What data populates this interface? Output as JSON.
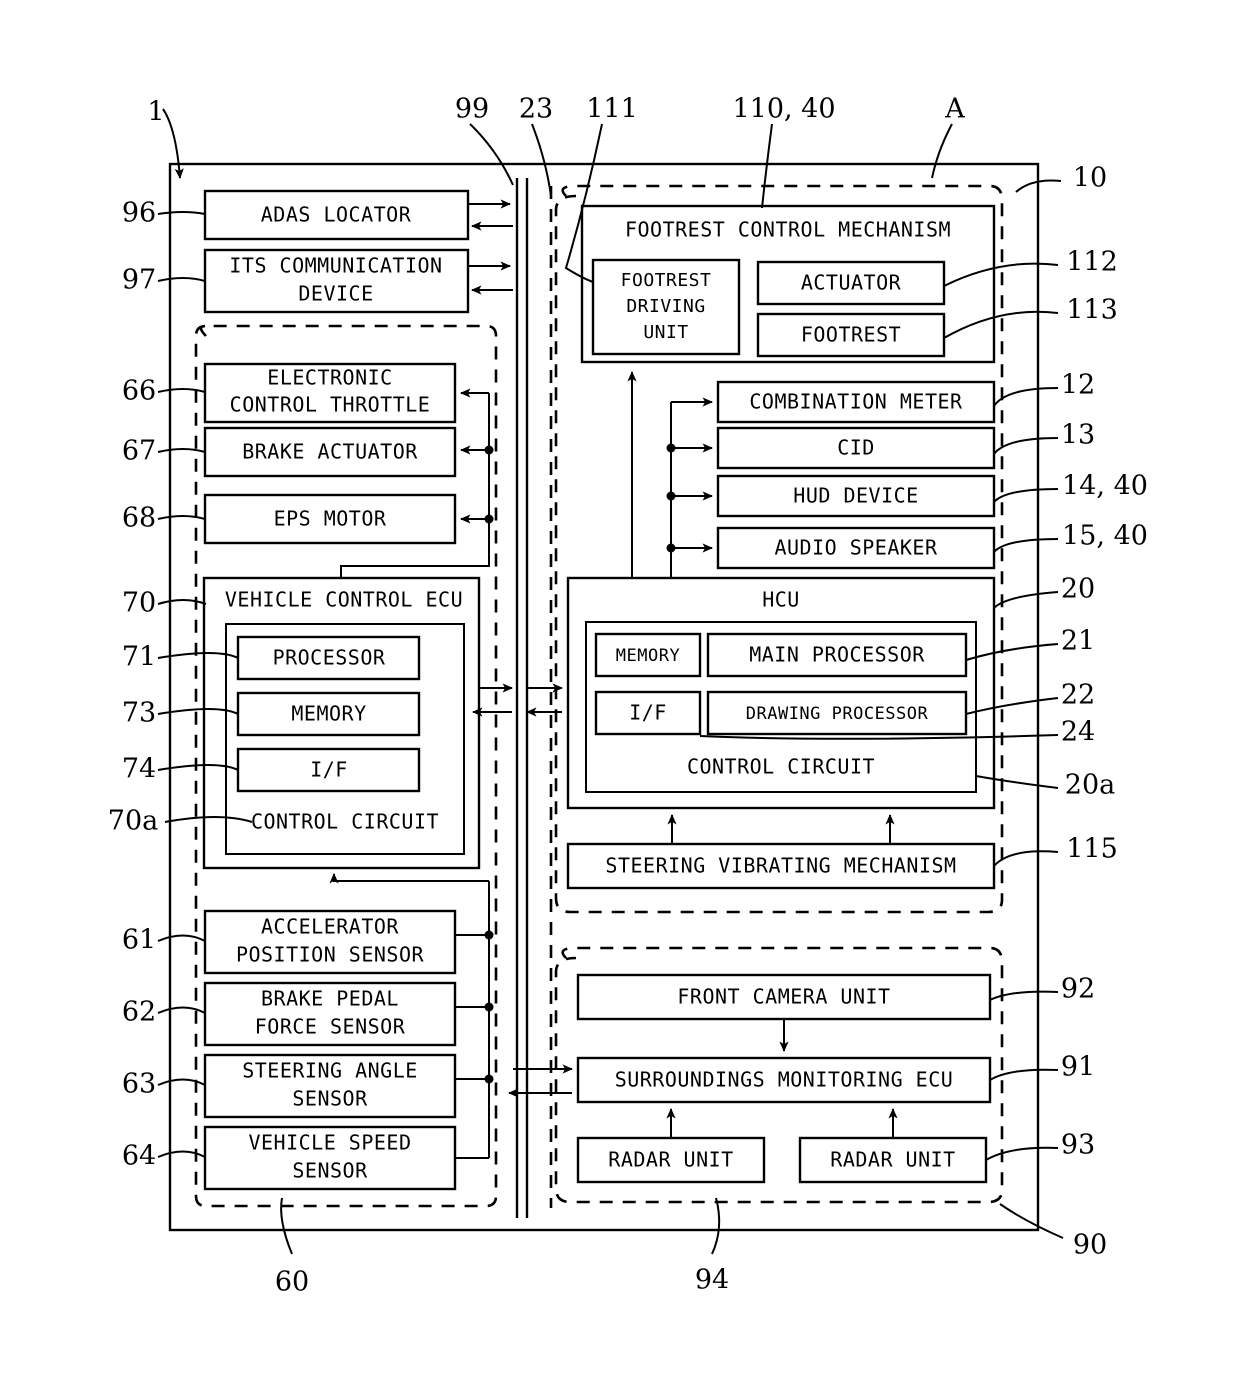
{
  "figure": {
    "type": "patent-block-diagram",
    "background": "#ffffff",
    "line_color": "#000000"
  },
  "blocks": {
    "adas_locator": "ADAS LOCATOR",
    "its_communication_device_l1": "ITS COMMUNICATION",
    "its_communication_device_l2": "DEVICE",
    "electronic_control_throttle_l1": "ELECTRONIC",
    "electronic_control_throttle_l2": "CONTROL THROTTLE",
    "brake_actuator": "BRAKE ACTUATOR",
    "eps_motor": "EPS MOTOR",
    "vehicle_control_ecu": "VEHICLE CONTROL ECU",
    "processor": "PROCESSOR",
    "memory": "MEMORY",
    "if": "I/F",
    "control_circuit": "CONTROL CIRCUIT",
    "accelerator_position_sensor_l1": "ACCELERATOR",
    "accelerator_position_sensor_l2": "POSITION SENSOR",
    "brake_pedal_force_sensor_l1": "BRAKE PEDAL",
    "brake_pedal_force_sensor_l2": "FORCE SENSOR",
    "steering_angle_sensor_l1": "STEERING ANGLE",
    "steering_angle_sensor_l2": "SENSOR",
    "vehicle_speed_sensor_l1": "VEHICLE SPEED",
    "vehicle_speed_sensor_l2": "SENSOR",
    "footrest_control_mechanism": "FOOTREST CONTROL MECHANISM",
    "footrest_driving_unit_l1": "FOOTREST",
    "footrest_driving_unit_l2": "DRIVING",
    "footrest_driving_unit_l3": "UNIT",
    "actuator": "ACTUATOR",
    "footrest": "FOOTREST",
    "combination_meter": "COMBINATION METER",
    "cid": "CID",
    "hud_device": "HUD DEVICE",
    "audio_speaker": "AUDIO SPEAKER",
    "hcu": "HCU",
    "hcu_memory": "MEMORY",
    "main_processor": "MAIN PROCESSOR",
    "hcu_if": "I/F",
    "drawing_processor": "DRAWING PROCESSOR",
    "hcu_control_circuit": "CONTROL CIRCUIT",
    "steering_vibrating_mechanism": "STEERING VIBRATING MECHANISM",
    "front_camera_unit": "FRONT CAMERA UNIT",
    "surroundings_monitoring_ecu": "SURROUNDINGS MONITORING ECU",
    "radar_unit_left": "RADAR UNIT",
    "radar_unit_right": "RADAR UNIT"
  },
  "reference_numerals": {
    "system": "1",
    "adas_locator": "96",
    "its_communication_device": "97",
    "electronic_control_throttle": "66",
    "brake_actuator": "67",
    "eps_motor": "68",
    "vehicle_control_ecu": "70",
    "processor": "71",
    "memory": "73",
    "if": "74",
    "control_circuit": "70a",
    "accelerator_position_sensor": "61",
    "brake_pedal_force_sensor": "62",
    "steering_angle_sensor": "63",
    "vehicle_speed_sensor": "64",
    "vehicle_control_group": "60",
    "communication_bus": "99",
    "internal_bus": "23",
    "footrest_driving_unit": "111",
    "footrest_control_mechanism": "110, 40",
    "hmi_system_marker": "A",
    "hmi_system": "10",
    "actuator": "112",
    "footrest": "113",
    "combination_meter": "12",
    "cid": "13",
    "hud_device": "14, 40",
    "audio_speaker": "15, 40",
    "hcu": "20",
    "main_processor": "21",
    "drawing_processor": "22",
    "if_hcu": "24",
    "hcu_control_circuit": "20a",
    "steering_vibrating_mechanism": "115",
    "front_camera_unit": "92",
    "surroundings_monitoring_ecu": "91",
    "radar_unit": "93",
    "surroundings_group": "90",
    "radar_group": "94"
  }
}
